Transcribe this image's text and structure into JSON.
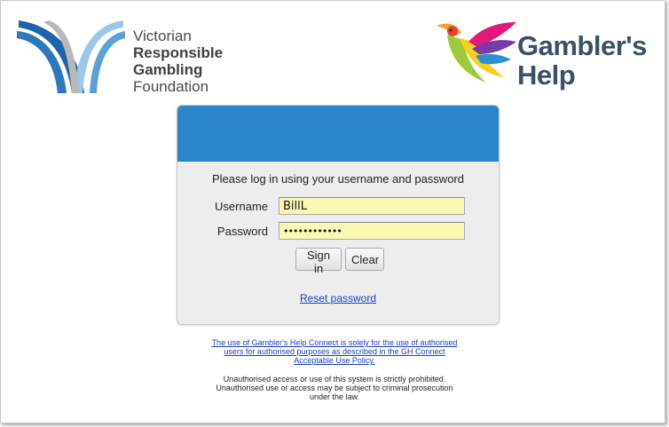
{
  "logos": {
    "vrgf": {
      "line1": "Victorian",
      "line2": "Responsible",
      "line3": "Gambling",
      "line4": "Foundation"
    },
    "gamblers_help": {
      "line1": "Gambler's",
      "line2": "Help"
    }
  },
  "login": {
    "prompt": "Please log in using your username and password",
    "username_label": "Username",
    "username_value": "BillL",
    "password_label": "Password",
    "password_value": "••••••••••••",
    "signin_label": "Sign in",
    "clear_label": "Clear",
    "reset_label": "Reset password"
  },
  "policy": {
    "line1": "The use of Gambler's Help Connect is solely for the use of authorised",
    "line2": "users for authorised purposes as described in the GH Connect",
    "line3": "Acceptable Use Policy."
  },
  "warning": {
    "line1": "Unauthorised access or use of this system is strictly prohibited.",
    "line2": "Unauthorised use or access may be subject to criminal prosecution",
    "line3": "under the law."
  },
  "colors": {
    "header_blue": "#2a86c9",
    "input_yellow": "#fbf8b4",
    "link_blue": "#1a3fc4",
    "gh_text": "#3a5068"
  }
}
